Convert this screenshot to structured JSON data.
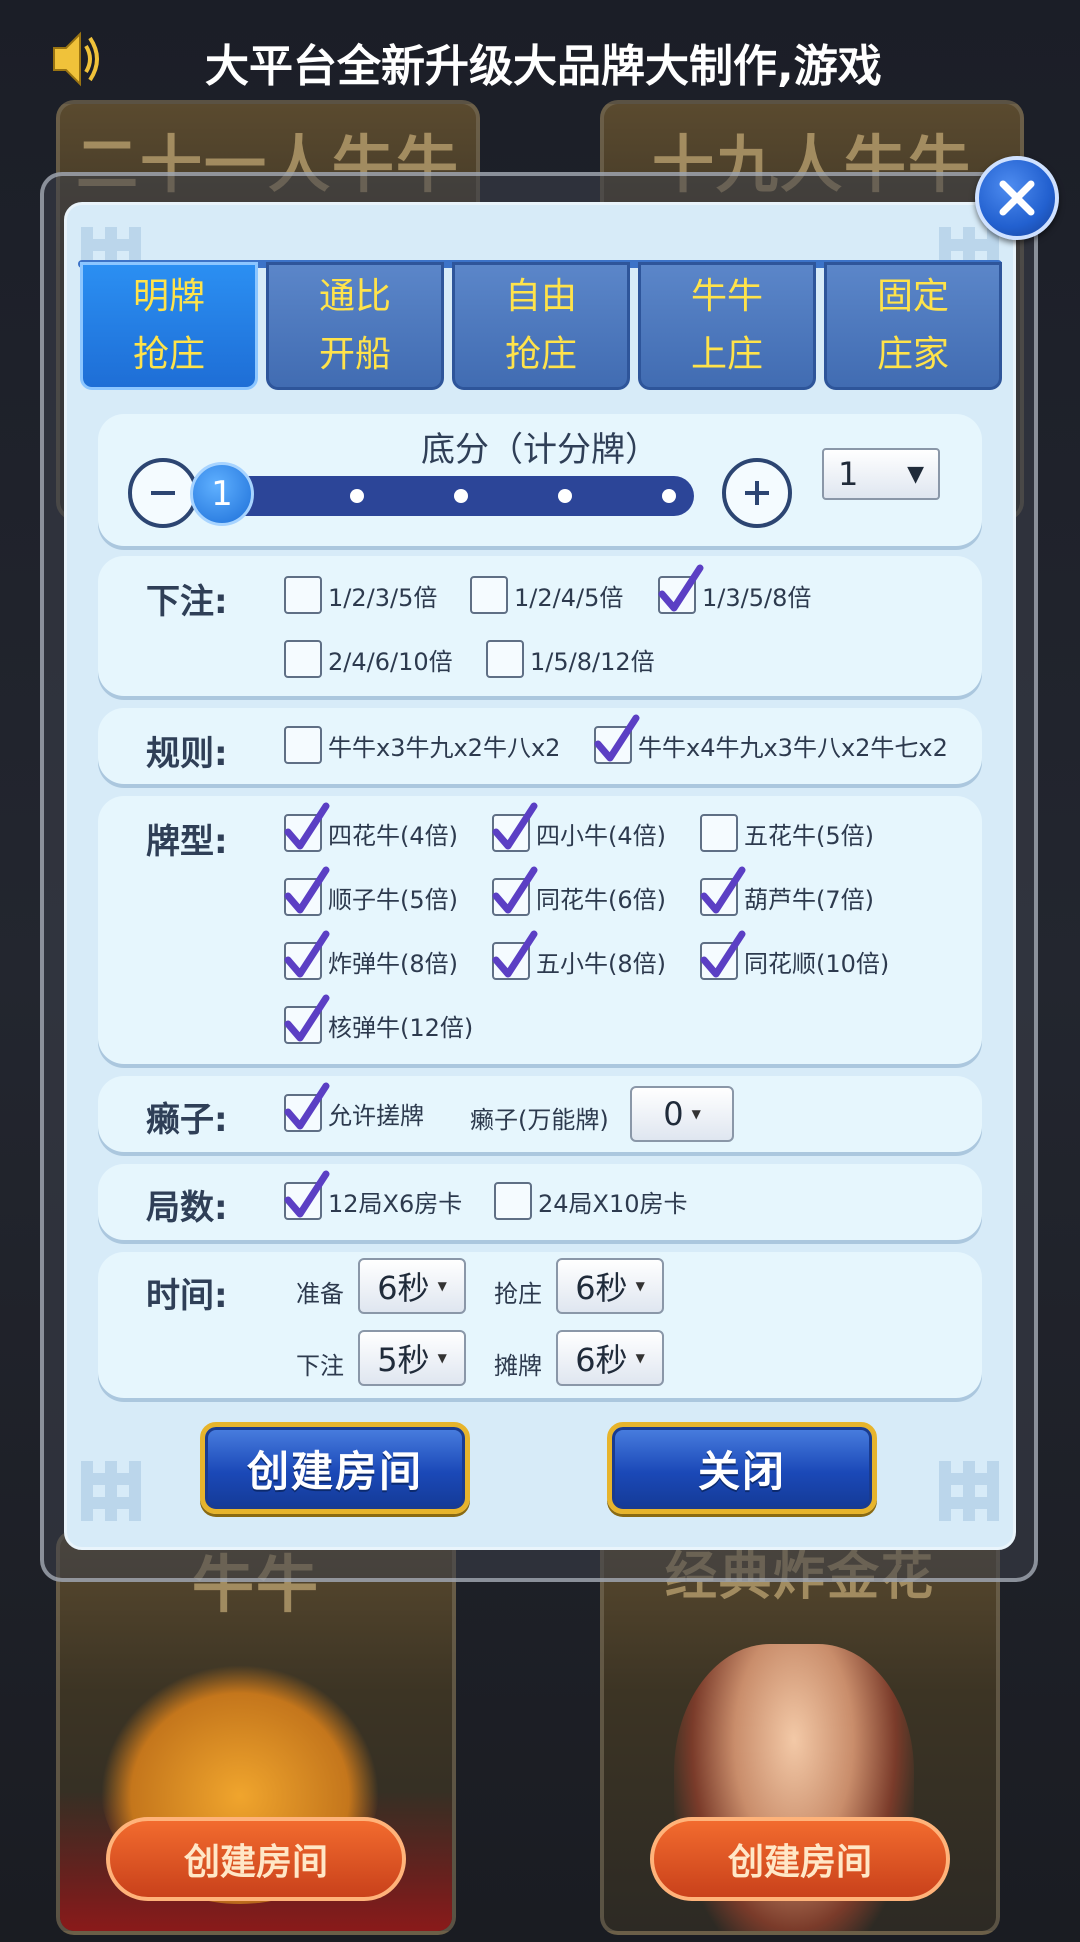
{
  "marquee": {
    "text": "大平台全新升级大品牌大制作,游戏"
  },
  "background_cards": [
    {
      "title": "二十一人牛牛"
    },
    {
      "title": "十九人牛牛"
    },
    {
      "title": "牛牛",
      "button": "创建房间"
    },
    {
      "title": "经典炸金花",
      "button": "创建房间"
    }
  ],
  "tabs": [
    {
      "line1": "明牌",
      "line2": "抢庄",
      "active": true
    },
    {
      "line1": "通比",
      "line2": "开船",
      "active": false
    },
    {
      "line1": "自由",
      "line2": "抢庄",
      "active": false
    },
    {
      "line1": "牛牛",
      "line2": "上庄",
      "active": false
    },
    {
      "line1": "固定",
      "line2": "庄家",
      "active": false
    }
  ],
  "base_score": {
    "title": "底分（计分牌）",
    "slider_value": "1",
    "select_value": "1",
    "slider_steps": 5,
    "slider_position": 1
  },
  "bet": {
    "label": "下注:",
    "options": [
      {
        "text": "1/2/3/5倍",
        "checked": false
      },
      {
        "text": "1/2/4/5倍",
        "checked": false
      },
      {
        "text": "1/3/5/8倍",
        "checked": true
      },
      {
        "text": "2/4/6/10倍",
        "checked": false
      },
      {
        "text": "1/5/8/12倍",
        "checked": false
      }
    ]
  },
  "rules": {
    "label": "规则:",
    "options": [
      {
        "text": "牛牛x3牛九x2牛八x2",
        "checked": false
      },
      {
        "text": "牛牛x4牛九x3牛八x2牛七x2",
        "checked": true
      }
    ]
  },
  "card_types": {
    "label": "牌型:",
    "options": [
      {
        "text": "四花牛(4倍)",
        "checked": true
      },
      {
        "text": "四小牛(4倍)",
        "checked": true
      },
      {
        "text": "五花牛(5倍)",
        "checked": false
      },
      {
        "text": "顺子牛(5倍)",
        "checked": true
      },
      {
        "text": "同花牛(6倍)",
        "checked": true
      },
      {
        "text": "葫芦牛(7倍)",
        "checked": true
      },
      {
        "text": "炸弹牛(8倍)",
        "checked": true
      },
      {
        "text": "五小牛(8倍)",
        "checked": true
      },
      {
        "text": "同花顺(10倍)",
        "checked": true
      },
      {
        "text": "核弹牛(12倍)",
        "checked": true
      }
    ]
  },
  "wildcard": {
    "label": "癞子:",
    "allow_text": "允许搓牌",
    "allow_checked": true,
    "count_label": "癞子(万能牌)",
    "count_value": "0"
  },
  "rounds": {
    "label": "局数:",
    "options": [
      {
        "text": "12局X6房卡",
        "checked": true
      },
      {
        "text": "24局X10房卡",
        "checked": false
      }
    ]
  },
  "time": {
    "label": "时间:",
    "ready_label": "准备",
    "ready_value": "6秒",
    "grab_label": "抢庄",
    "grab_value": "6秒",
    "bet_label": "下注",
    "bet_value": "5秒",
    "show_label": "摊牌",
    "show_value": "6秒"
  },
  "buttons": {
    "create": "创建房间",
    "close": "关闭"
  },
  "colors": {
    "tab_text": "#ffe34a",
    "panel_bg": "#e6f6fd",
    "dialog_bg": "#d7ebf8",
    "check_purple": "#5b3fc4",
    "button_border_gold": "#e7b42c"
  },
  "icons": {
    "speaker": "speaker-icon",
    "close": "close-x-icon",
    "minus": "minus-icon",
    "plus": "plus-icon",
    "check": "check-icon"
  }
}
